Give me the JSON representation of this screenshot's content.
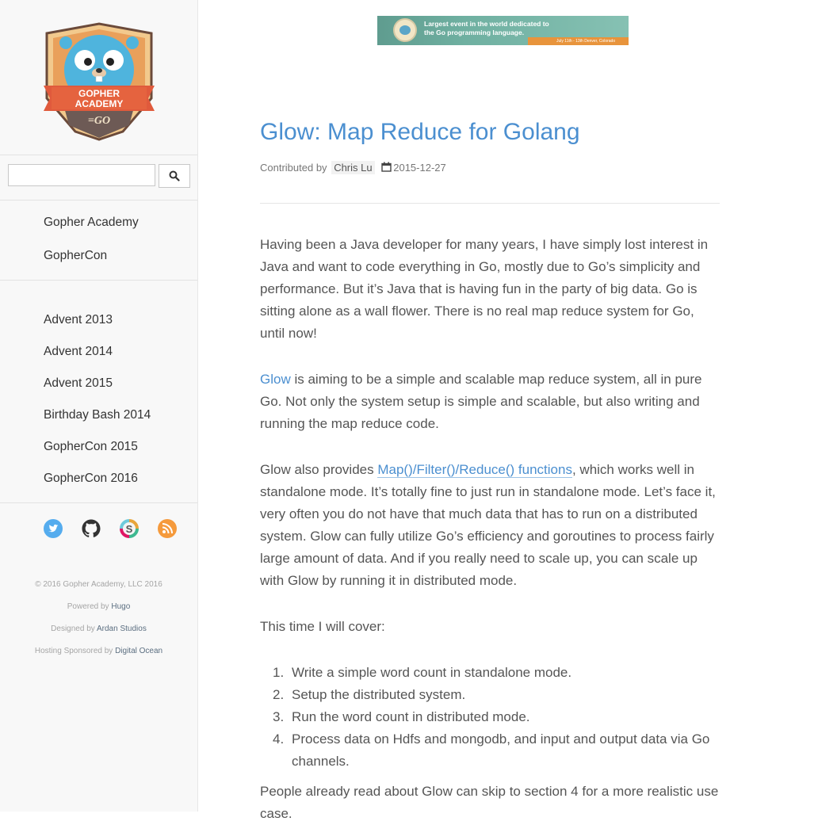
{
  "sidebar": {
    "logo_text": "GOPHER ACADEMY",
    "logo_sub": "=GO",
    "search": {
      "value": "",
      "placeholder": ""
    },
    "primary_links": [
      "Gopher Academy",
      "GopherCon"
    ],
    "event_links": [
      "Advent 2013",
      "Advent 2014",
      "Advent 2015",
      "Birthday Bash 2014",
      "GopherCon 2015",
      "GopherCon 2016"
    ],
    "social_icons": [
      "twitter-icon",
      "github-icon",
      "slack-icon",
      "rss-icon"
    ],
    "colors": {
      "twitter": "#55acee",
      "github": "#333333",
      "slack": "#e8a53b",
      "rss": "#f59a3c"
    },
    "footer": {
      "copyright": "© 2016 Gopher Academy, LLC 2016",
      "powered_prefix": "Powered by",
      "powered_link": "Hugo",
      "designed_prefix": "Designed by",
      "designed_link": "Ardan Studios",
      "hosting_prefix": "Hosting Sponsored by",
      "hosting_link": "Digital Ocean"
    }
  },
  "banner": {
    "line1": "Largest event in the world dedicated to",
    "line2": "the Go programming language.",
    "small": "July 11th - 13th Denver, Colorado"
  },
  "post": {
    "title": "Glow: Map Reduce for Golang",
    "contributed_by": "Contributed by",
    "author": "Chris Lu",
    "date": "2015-12-27",
    "p1": "Having been a Java developer for many years, I have simply lost interest in Java and want to code everything in Go, mostly due to Go’s simplicity and performance. But it’s Java that is having fun in the party of big data. Go is sitting alone as a wall flower. There is no real map reduce system for Go, until now!",
    "p2_link": "Glow",
    "p2_rest": " is aiming to be a simple and scalable map reduce system, all in pure Go. Not only the system setup is simple and scalable, but also writing and running the map reduce code.",
    "p3_start": "Glow also provides ",
    "p3_link": "Map()/Filter()/Reduce() functions",
    "p3_rest": ", which works well in standalone mode. It’s totally fine to just run in standalone mode. Let’s face it, very often you do not have that much data that has to run on a distributed system. Glow can fully utilize Go’s efficiency and goroutines to process fairly large amount of data. And if you really need to scale up, you can scale up with Glow by running it in distributed mode.",
    "p4": "This time I will cover:",
    "list": [
      {
        "num": "1.",
        "text": "Write a simple word count in standalone mode."
      },
      {
        "num": "2.",
        "text": "Setup the distributed system."
      },
      {
        "num": "3.",
        "text": "Run the word count in distributed mode."
      },
      {
        "num": "4.",
        "text": "Process data on Hdfs and mongodb, and input and output data via Go channels."
      }
    ],
    "p5": "People already read about Glow can skip to section 4 for a more realistic use case."
  }
}
